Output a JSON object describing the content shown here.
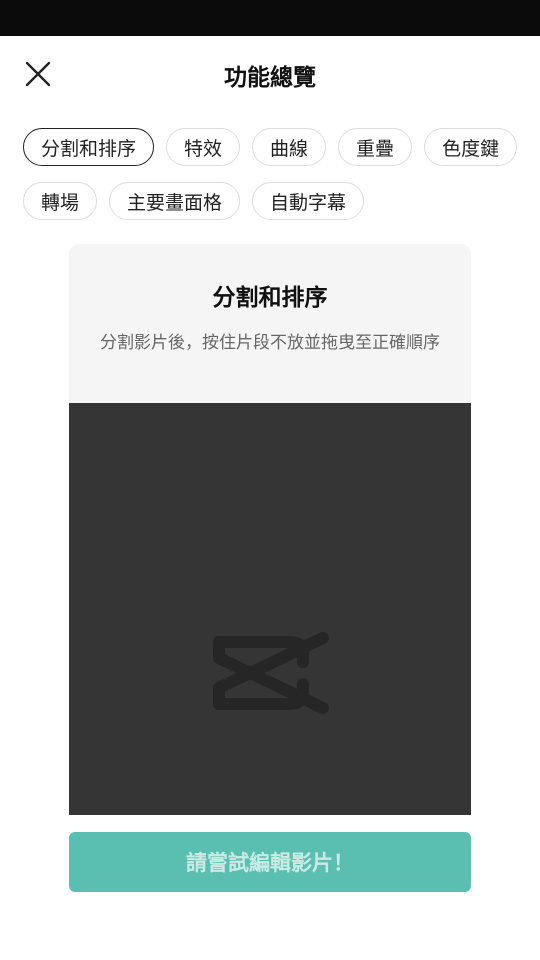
{
  "header": {
    "title": "功能總覽",
    "close_icon": "close-icon"
  },
  "chips": {
    "row1": [
      "分割和排序",
      "特效",
      "曲線",
      "重疊",
      "色度鍵"
    ],
    "row2": [
      "轉場",
      "主要畫面格",
      "自動字幕"
    ],
    "selected": "分割和排序"
  },
  "card": {
    "title": "分割和排序",
    "description": "分割影片後，按住片段不放並拖曳至正確順序",
    "preview_icon": "capcut-logo-icon"
  },
  "cta": {
    "label": "請嘗試編輯影片！"
  },
  "colors": {
    "accent": "#5abfb0",
    "preview_bg": "#353535",
    "status_bar": "#0b0b0b"
  }
}
